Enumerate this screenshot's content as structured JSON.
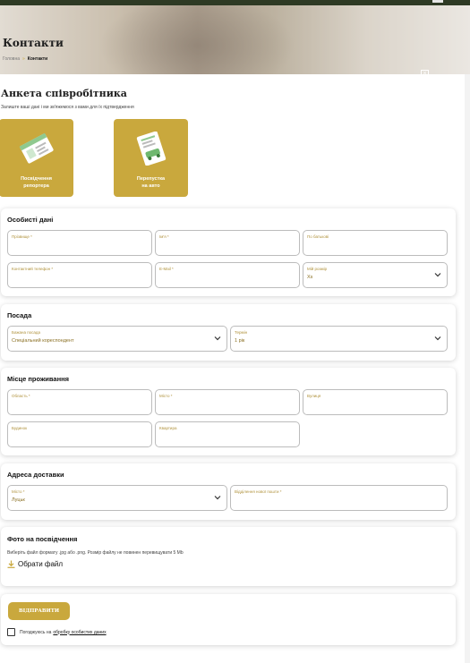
{
  "header": {
    "title": "Контакти",
    "breadcrumb": {
      "home": "Головна",
      "separator": "»",
      "current": "Контакти"
    },
    "close_icon": "×"
  },
  "form": {
    "title": "Анкета співробітника",
    "subtitle": "Залиште ваші дані і ми зв'яжемося з вами для їх підтвердження"
  },
  "doc_cards": [
    {
      "label_line1": "Посвідчення",
      "label_line2": "репортера",
      "icon": "id-card-icon"
    },
    {
      "label_line1": "Перепустка",
      "label_line2": "на авто",
      "icon": "car-pass-icon"
    }
  ],
  "personal": {
    "title": "Особисті дані",
    "surname": "Прізвище *",
    "name": "Ім'я *",
    "patronymic": "По батькові",
    "phone": "Контактний телефон *",
    "email": "E-Mail *",
    "size_label": "Мій розмір",
    "size_value": "Xs"
  },
  "position": {
    "title": "Посада",
    "role_label": "Бажана посада",
    "role_value": "Спеціальний кореспондент",
    "term_label": "Термін",
    "term_value": "1 рік"
  },
  "residence": {
    "title": "Місце проживання",
    "region": "Область *",
    "city": "Місто *",
    "street": "Вулиця",
    "house": "Будинок",
    "apartment": "Квартира"
  },
  "delivery": {
    "title": "Адреса доставки",
    "city_label": "Місто *",
    "city_value": "Луцьк",
    "post_office": "Відділення нової пошти *"
  },
  "photo": {
    "title": "Фото на посвідчення",
    "hint": "Виберіть файл формату .jpg або .png. Розмір файлу не повинен перевищувати 5 Mb",
    "choose_file": "Обрати файл"
  },
  "submit": {
    "button": "ВІДПРАВИТИ",
    "consent_text": "Погоджуюсь на",
    "consent_link": "обробку особистих даних"
  },
  "colors": {
    "accent": "#c9a83d",
    "dark": "#2e3a24"
  }
}
